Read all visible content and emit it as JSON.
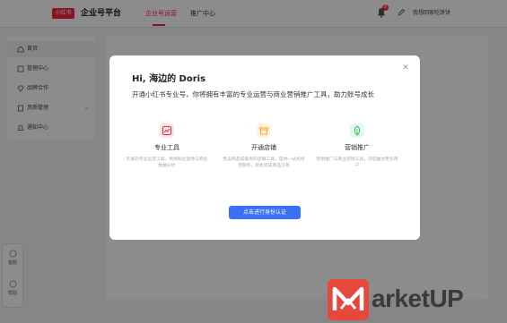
{
  "header": {
    "logo_text": "小红书",
    "brand_title": "企业号平台",
    "tabs": [
      {
        "label": "企业号运营"
      },
      {
        "label": "推广中心"
      }
    ],
    "notification_count": "8",
    "account_name": "我想回家吃饼饼"
  },
  "sidebar": {
    "items": [
      {
        "label": "首页"
      },
      {
        "label": "管理中心"
      },
      {
        "label": "品牌合作"
      },
      {
        "label": "资质管理"
      },
      {
        "label": "通知中心"
      }
    ]
  },
  "float_panel": {
    "items": [
      {
        "label": "客服"
      },
      {
        "label": "帮助"
      }
    ]
  },
  "modal": {
    "title": "Hi, 海边的 Doris",
    "subtitle": "开通小红书专业号，你将拥有丰富的专业运营与商业营销推广工具，助力账号成长",
    "features": [
      {
        "title": "专业工具",
        "desc": "丰富的专业运营工具，例如粉丝画像与商业数据分析",
        "icon": "trend-chart-icon"
      },
      {
        "title": "开通店铺",
        "desc": "售卖商品或服务的店铺工具，提供一站式经营服务，轻松完成商品交易",
        "icon": "shop-icon"
      },
      {
        "title": "营销推广",
        "desc": "营销推广与商业营销工具，深度触达更多用户",
        "icon": "leaf-icon"
      }
    ],
    "cta_label": "点击进行身份认证"
  },
  "colors": {
    "brand_red": "#ff2442",
    "cta_blue": "#3a6ff7",
    "watermark_red": "#e8473c"
  },
  "watermark": {
    "text": "arketUP"
  }
}
